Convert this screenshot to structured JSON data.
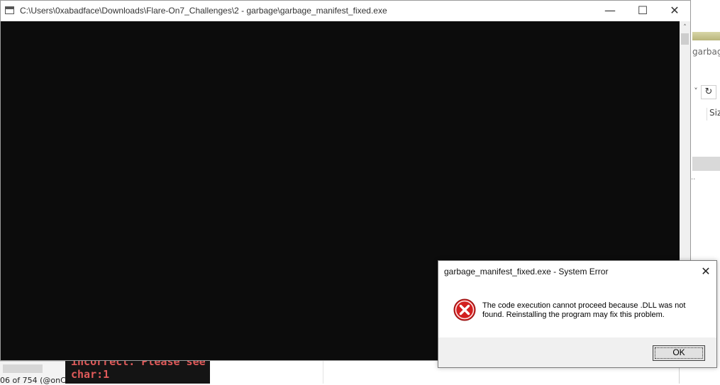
{
  "console": {
    "title": "C:\\Users\\0xabadface\\Downloads\\Flare-On7_Challenges\\2 - garbage\\garbage_manifest_fixed.exe",
    "minimize_glyph": "—",
    "maximize_glyph": "☐",
    "close_glyph": "✕",
    "scroll_up_glyph": "˄"
  },
  "background_explorer": {
    "path_fragment": "garbage",
    "dropdown_glyph": "˅",
    "refresh_glyph": "↻",
    "size_header": "Size",
    "ellipsis": ".."
  },
  "background_terminal": {
    "line1": "incorrect. Please see",
    "line2": "char:1",
    "status_text": "06 of 754 (@onC"
  },
  "dialog": {
    "title": "garbage_manifest_fixed.exe - System Error",
    "message": "The code execution cannot proceed because .DLL was not found. Reinstalling the program may fix this problem.",
    "ok_label": "OK",
    "close_glyph": "✕"
  },
  "colors": {
    "console_bg": "#0c0c0c",
    "terminal_text": "#e05a5a",
    "error_red": "#d31f1f"
  }
}
